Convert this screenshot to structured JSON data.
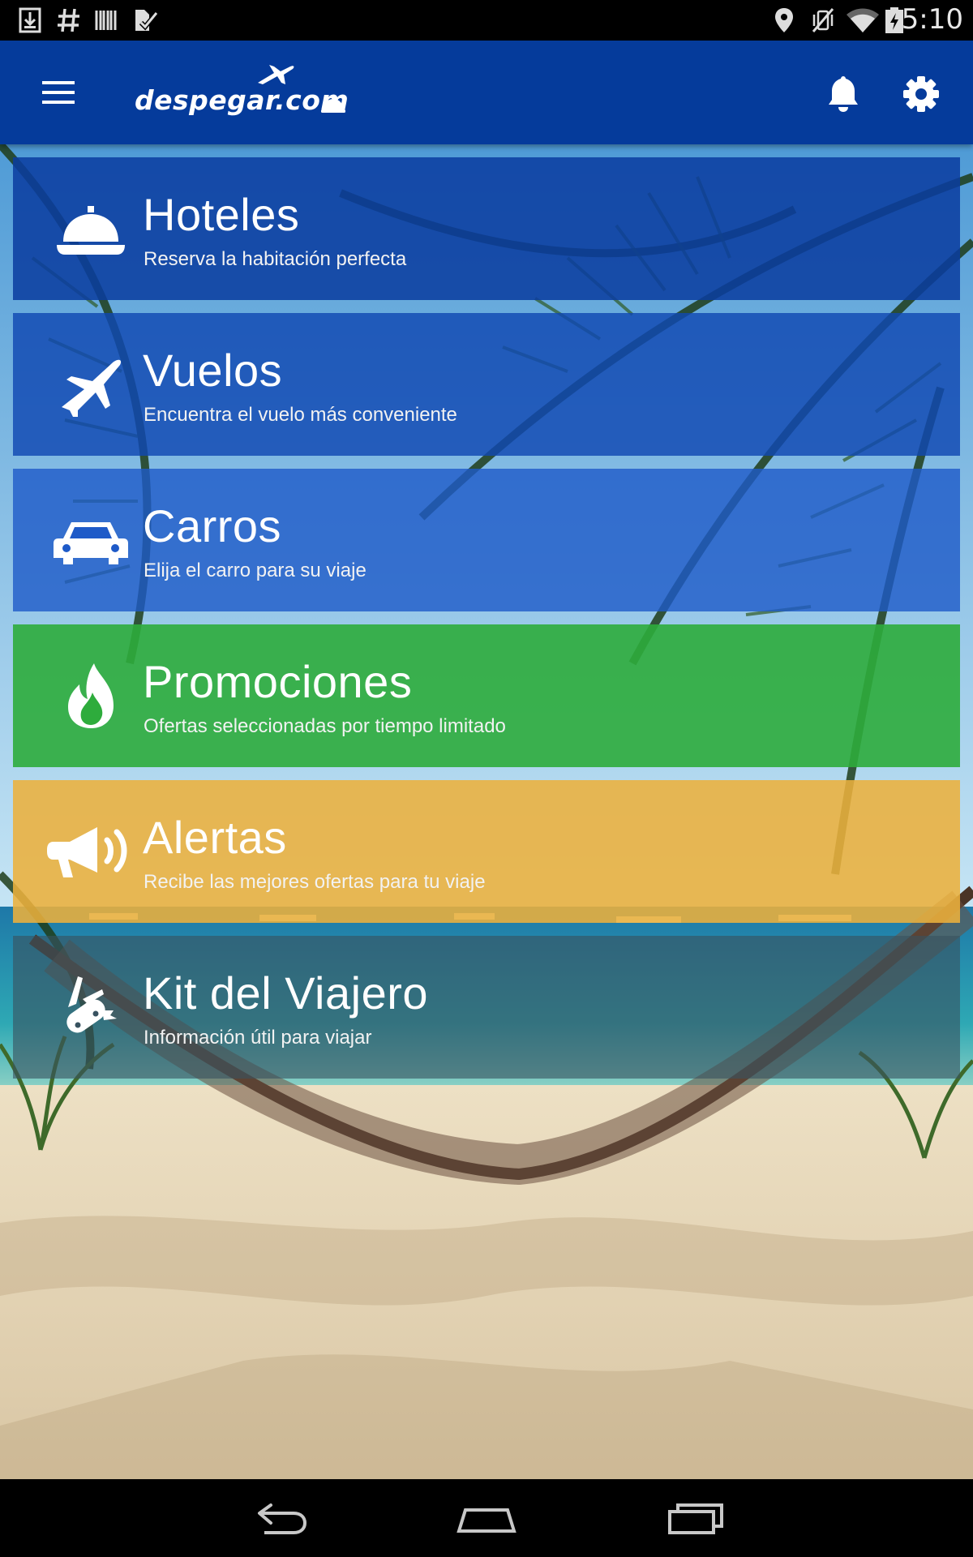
{
  "status_bar": {
    "time": "5:10",
    "icons": [
      "download-icon",
      "hash-icon",
      "barcode-icon",
      "task-icon",
      "location-icon",
      "vibrate-off-icon",
      "wifi-icon",
      "battery-icon"
    ]
  },
  "app_bar": {
    "logo_text": "despegar.com",
    "color": "#053b9b",
    "icons": [
      "hamburger-menu-icon",
      "bell-icon",
      "gear-icon"
    ]
  },
  "menu": {
    "items": [
      {
        "id": "hoteles",
        "title": "Hoteles",
        "subtitle": "Reserva la habitación perfecta",
        "icon": "hotel-bell-icon",
        "color": "#0a3ca0"
      },
      {
        "id": "vuelos",
        "title": "Vuelos",
        "subtitle": "Encuentra el vuelo más conveniente",
        "icon": "airplane-icon",
        "color": "#1048b2"
      },
      {
        "id": "carros",
        "title": "Carros",
        "subtitle": "Elija el carro para su viaje",
        "icon": "car-icon",
        "color": "#1e5ac8"
      },
      {
        "id": "promociones",
        "title": "Promociones",
        "subtitle": "Ofertas seleccionadas por tiempo limitado",
        "icon": "fire-icon",
        "color": "#2eac3c"
      },
      {
        "id": "alertas",
        "title": "Alertas",
        "subtitle": "Recibe las mejores ofertas para tu viaje",
        "icon": "megaphone-icon",
        "color": "#ecb03c"
      },
      {
        "id": "kit",
        "title": "Kit del Viajero",
        "subtitle": "Información útil para viajar",
        "icon": "swiss-knife-icon",
        "color": "#385260"
      }
    ]
  },
  "nav_bar": {
    "icons": [
      "back-icon",
      "home-icon",
      "recent-apps-icon"
    ]
  }
}
